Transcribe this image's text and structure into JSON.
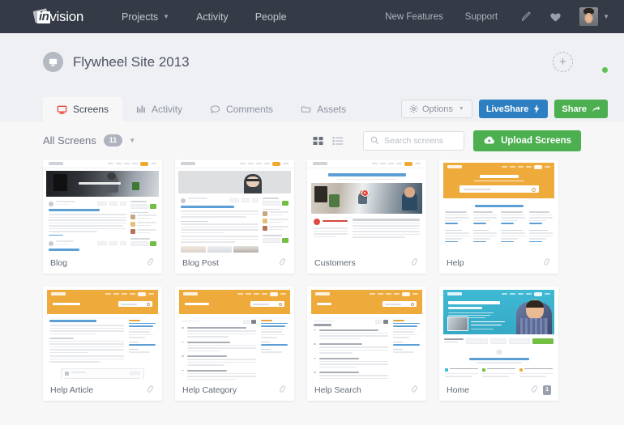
{
  "topnav": {
    "logo_in": "in",
    "logo_vision": "vision",
    "links": [
      {
        "label": "Projects",
        "caret": true
      },
      {
        "label": "Activity",
        "caret": false
      },
      {
        "label": "People",
        "caret": false
      }
    ],
    "right_links": [
      {
        "label": "New Features"
      },
      {
        "label": "Support"
      }
    ],
    "icons": [
      {
        "name": "pen-icon"
      },
      {
        "name": "heart-icon"
      }
    ]
  },
  "project": {
    "title": "Flywheel Site 2013",
    "icon": "monitor-icon",
    "add_label": "+",
    "member_status": "online"
  },
  "tabs": [
    {
      "label": "Screens",
      "icon": "monitor-icon",
      "active": true
    },
    {
      "label": "Activity",
      "icon": "bar-chart-icon",
      "active": false
    },
    {
      "label": "Comments",
      "icon": "comment-bubble-icon",
      "active": false
    },
    {
      "label": "Assets",
      "icon": "folder-icon",
      "active": false
    }
  ],
  "actions": {
    "options_label": "Options",
    "liveshare_label": "LiveShare",
    "share_label": "Share"
  },
  "filter": {
    "all_screens_label": "All Screens",
    "count": "11",
    "grid_view": "grid-view-icon",
    "list_view": "list-view-icon"
  },
  "search": {
    "placeholder": "Search screens",
    "value": ""
  },
  "upload": {
    "label": "Upload Screens",
    "icon": "cloud-upload-icon"
  },
  "screens": [
    {
      "name": "Blog",
      "badge": "",
      "theme": "blog"
    },
    {
      "name": "Blog Post",
      "badge": "",
      "theme": "blogpost"
    },
    {
      "name": "Customers",
      "badge": "",
      "theme": "customers"
    },
    {
      "name": "Help",
      "badge": "",
      "theme": "help"
    },
    {
      "name": "Help Article",
      "badge": "",
      "theme": "helparticle"
    },
    {
      "name": "Help Category",
      "badge": "",
      "theme": "helpcategory"
    },
    {
      "name": "Help Search",
      "badge": "",
      "theme": "helpsearch"
    },
    {
      "name": "Home",
      "badge": "1",
      "theme": "home"
    }
  ],
  "colors": {
    "nav_bg": "#343b47",
    "header_bg": "#eef0f4",
    "content_bg": "#f7f7f8",
    "accent_red": "#e8453c",
    "blue": "#2d7fc1",
    "green": "#4caf50",
    "amber": "#f0a830",
    "cyan": "#3fb9d4",
    "status_green": "#5fc24e"
  }
}
